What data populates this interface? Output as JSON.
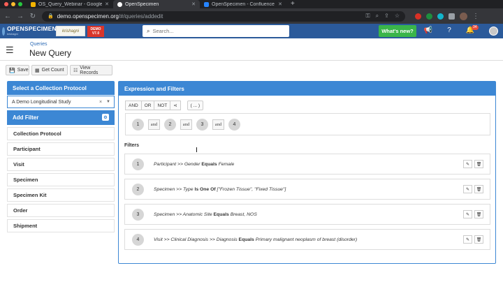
{
  "browser": {
    "tabs": [
      {
        "label": "OS_Query_Webinar - Google Sli",
        "favicon_color": "#f4b400"
      },
      {
        "label": "OpenSpecimen",
        "favicon_color": "#ffffff",
        "active": true
      },
      {
        "label": "OpenSpecimen - Confluence",
        "favicon_color": "#2684ff"
      }
    ],
    "new_tab": "+",
    "url_domain": "demo.openspecimen.org",
    "url_path": "/#/queries/addedit"
  },
  "app": {
    "logo_text": "OPENSPECIMEN",
    "logo_sub": "krishagni",
    "partner_logo_text": "krishagni",
    "demo_badge_line1": "DEMO",
    "demo_badge_line2": "V7.0",
    "search_placeholder": "Search...",
    "whats_new": "What's new?",
    "notification_count": "34"
  },
  "page": {
    "breadcrumb": "Queries",
    "title": "New Query",
    "toolbar": {
      "save": "Save",
      "get_count": "Get Count",
      "view_records": "View Records"
    }
  },
  "left_panel": {
    "title": "Select a Collection Protocol",
    "selected_cp": "A Demo Longitudinal Study",
    "add_filter": "Add Filter",
    "items": [
      "Collection Protocol",
      "Participant",
      "Visit",
      "Specimen",
      "Specimen Kit",
      "Order",
      "Shipment"
    ]
  },
  "right_panel": {
    "title": "Expression and Filters",
    "operators": [
      "AND",
      "OR",
      "NOT",
      "<",
      "( ... )"
    ],
    "expression": [
      "1",
      "and",
      "2",
      "and",
      "3",
      "and",
      "4"
    ],
    "filters_label": "Filters",
    "filters": [
      {
        "num": "1",
        "field": "Participant >> Gender",
        "op": "Equals",
        "value": "Female"
      },
      {
        "num": "2",
        "field": "Specimen >> Type",
        "op": "Is One Of",
        "value": "[\"Frozen Tissue\", \"Fixed Tissue\"]"
      },
      {
        "num": "3",
        "field": "Specimen >> Anatomic Site",
        "op": "Equals",
        "value": "Breast, NOS"
      },
      {
        "num": "4",
        "field": "Visit >> Clinical Diagnosis >> Diagnosis",
        "op": "Equals",
        "value": "Primary malignant neoplasm of breast (disorder)"
      }
    ]
  }
}
